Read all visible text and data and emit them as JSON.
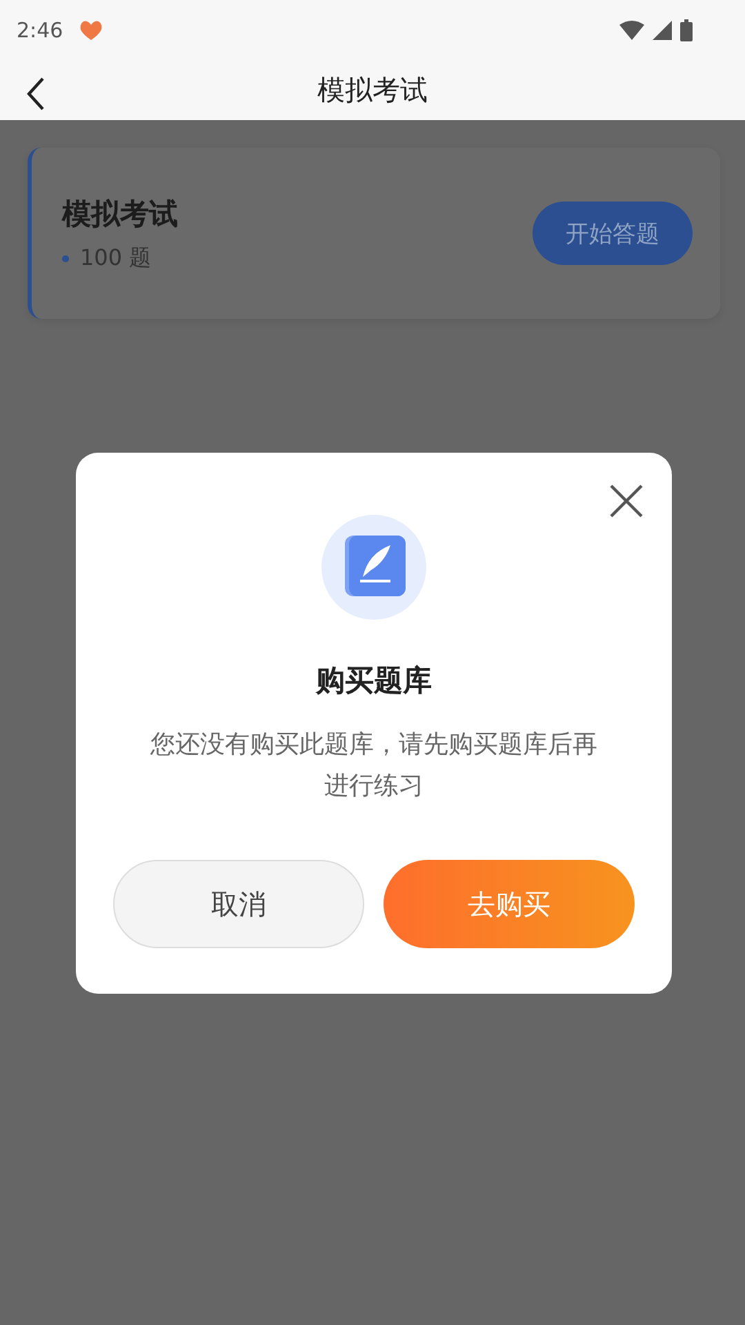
{
  "status_bar": {
    "time": "2:46"
  },
  "header": {
    "title": "模拟考试"
  },
  "exam_card": {
    "title": "模拟考试",
    "count": "100 题",
    "button": "开始答题"
  },
  "dialog": {
    "title": "购买题库",
    "message": "您还没有购买此题库，请先购买题库后再进行练习",
    "buttons": [
      {
        "label": "取消",
        "kind": "secondary"
      },
      {
        "label": "去购买",
        "kind": "primary"
      }
    ]
  }
}
